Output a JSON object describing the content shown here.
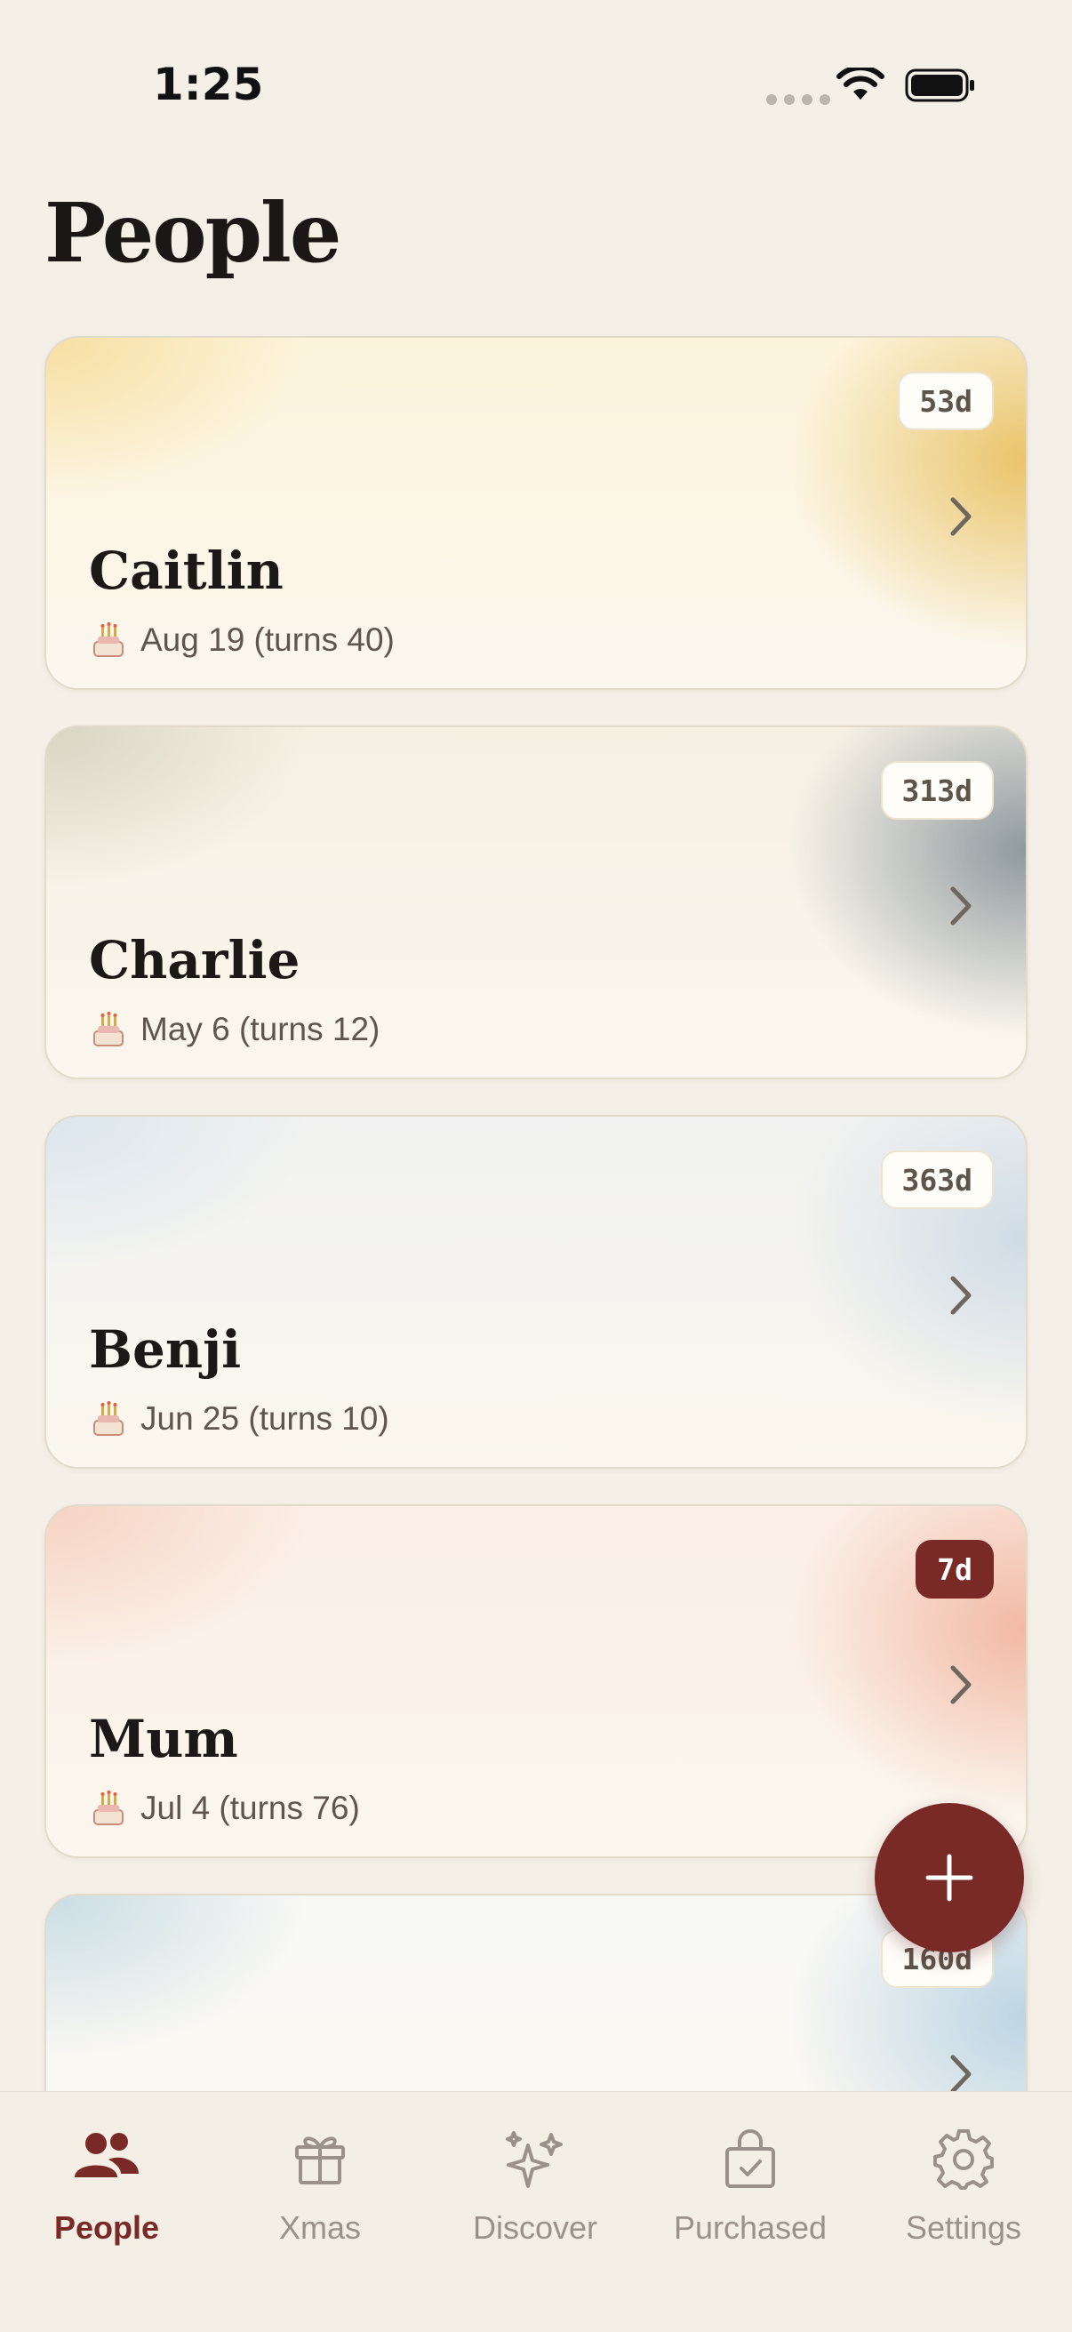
{
  "status_bar": {
    "time": "1:25"
  },
  "page": {
    "title": "People"
  },
  "people": [
    {
      "name": "Caitlin",
      "birthday": "Aug 19 (turns 40)",
      "days": "53d",
      "urgent": false,
      "palette": [
        "#f7dfa0",
        "#fdf4dc",
        "#e9c46a"
      ]
    },
    {
      "name": "Charlie",
      "birthday": "May 6 (turns 12)",
      "days": "313d",
      "urgent": false,
      "palette": [
        "#d8d5c2",
        "#f6f0e3",
        "#8f9aa0"
      ]
    },
    {
      "name": "Benji",
      "birthday": "Jun 25 (turns 10)",
      "days": "363d",
      "urgent": false,
      "palette": [
        "#dbe6ee",
        "#f1f2f1",
        "#cfdce6"
      ]
    },
    {
      "name": "Mum",
      "birthday": "Jul 4 (turns 76)",
      "days": "7d",
      "urgent": true,
      "palette": [
        "#f6d3c2",
        "#fbeee6",
        "#f2b9a4"
      ]
    },
    {
      "name": "",
      "birthday": "",
      "days": "160d",
      "urgent": false,
      "palette": [
        "#c9dde3",
        "#f8f8f6",
        "#bcd5e4"
      ]
    }
  ],
  "fab": {
    "icon": "plus-icon"
  },
  "tabs": [
    {
      "label": "People",
      "icon": "people-icon",
      "active": true
    },
    {
      "label": "Xmas",
      "icon": "gift-icon",
      "active": false
    },
    {
      "label": "Discover",
      "icon": "sparkles-icon",
      "active": false
    },
    {
      "label": "Purchased",
      "icon": "bag-check-icon",
      "active": false
    },
    {
      "label": "Settings",
      "icon": "gear-icon",
      "active": false
    }
  ],
  "colors": {
    "accent": "#7a2a26",
    "background": "#f4f0e7",
    "tab_inactive": "#9a928a"
  }
}
